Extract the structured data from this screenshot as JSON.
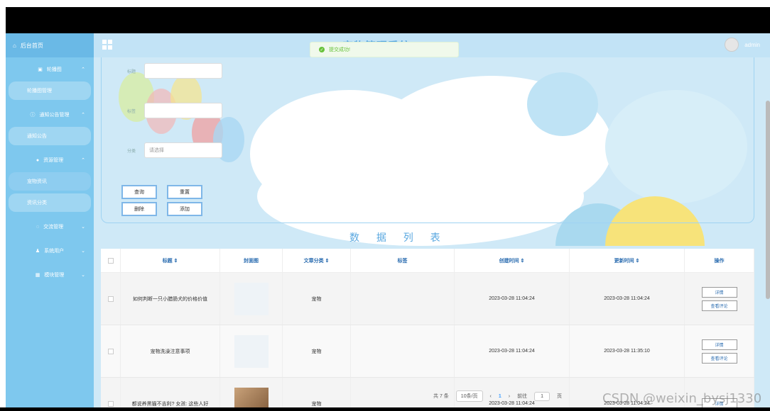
{
  "sidebar": {
    "home": "后台首页",
    "groups": [
      {
        "label": "轮播图",
        "icon": "image-icon",
        "items": [
          "轮播图管理"
        ]
      },
      {
        "label": "通知公告管理",
        "icon": "info-icon",
        "items": [
          "通知公告"
        ]
      },
      {
        "label": "资源管理",
        "icon": "location-icon",
        "items": [
          "宠物资讯",
          "资讯分类"
        ]
      },
      {
        "label": "交流管理",
        "icon": "chat-icon",
        "items": []
      },
      {
        "label": "系统用户",
        "icon": "user-icon",
        "items": []
      },
      {
        "label": "模块管理",
        "icon": "grid-icon",
        "items": []
      }
    ]
  },
  "header": {
    "title": "宠物管理系统",
    "user": "admin"
  },
  "toast": {
    "message": "提交成功!"
  },
  "search_form": {
    "title_label": "标题",
    "tag_label": "标签",
    "category_label": "分类",
    "category_placeholder": "请选择",
    "query_button": "查询",
    "reset_button": "重置",
    "delete_button": "删除",
    "add_button": "添加"
  },
  "list_title": "数 据 列 表",
  "table": {
    "headers": [
      "标题 ⇕",
      "封面图",
      "文章分类 ⇕",
      "标签",
      "创建时间 ⇕",
      "更新时间 ⇕",
      "操作"
    ],
    "rows": [
      {
        "title": "如何判断一只小腊肠犬的价格价值",
        "category": "宠物",
        "tag": "",
        "created": "2023-03-28 11:04:24",
        "updated": "2023-03-28 11:04:24"
      },
      {
        "title": "宠物洗澡注意事项",
        "category": "宠物",
        "tag": "",
        "created": "2023-03-28 11:04:24",
        "updated": "2023-03-28 11:35:10"
      },
      {
        "title": "都说养黑猫不吉利? 女孩: 这些人好",
        "category": "宠物",
        "tag": "",
        "created": "2023-03-28 11:04:24",
        "updated": "2023-03-28 11:04:24"
      }
    ],
    "detail_button": "详情",
    "comment_button": "查看评论"
  },
  "pager": {
    "total": "共 7 条",
    "page_size": "10条/页",
    "current_page": "1",
    "goto_prefix": "前往",
    "goto_value": "1",
    "goto_suffix": "页"
  },
  "watermark": "CSDN @weixin_bysj1330"
}
